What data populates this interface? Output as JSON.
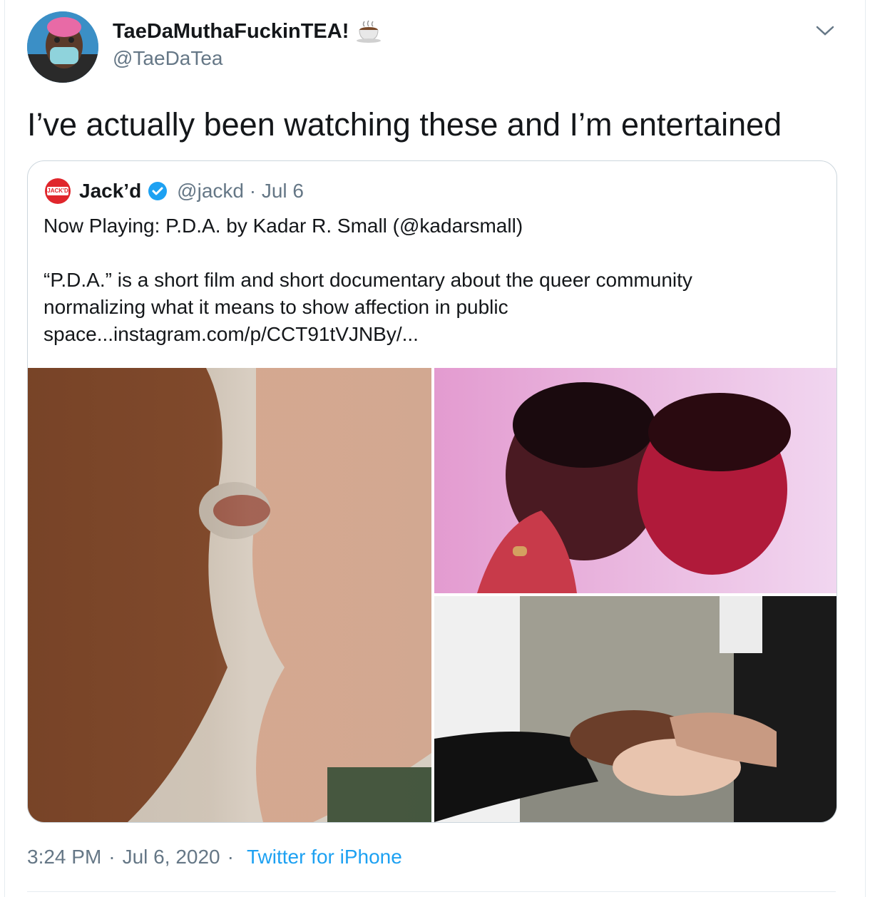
{
  "tweet": {
    "display_name": "TaeDaMuthaFuckinTEA!",
    "name_emoji": "coffee-cup-emoji",
    "handle": "@TaeDaTea",
    "text": "I’ve actually been watching these and I’m entertained",
    "time": "3:24 PM",
    "dot1": "·",
    "date": "Jul 6, 2020",
    "dot2": "·",
    "source": "Twitter for iPhone"
  },
  "quoted": {
    "logo_text": "JACK'D",
    "display_name": "Jack’d",
    "verified": true,
    "handle_date": "@jackd · Jul 6",
    "line1": "Now Playing: P.D.A. by Kadar R. Small (@kadarsmall)",
    "line2": "“P.D.A.” is a short film and short documentary about the queer community",
    "line3": "normalizing what it means to show affection in public",
    "line4": "space...instagram.com/p/CCT91tVJNBy/..."
  },
  "colors": {
    "text": "#14171a",
    "secondary": "#657786",
    "link": "#1da1f2",
    "border": "#ccd6dd",
    "logo_red": "#e0262c"
  }
}
